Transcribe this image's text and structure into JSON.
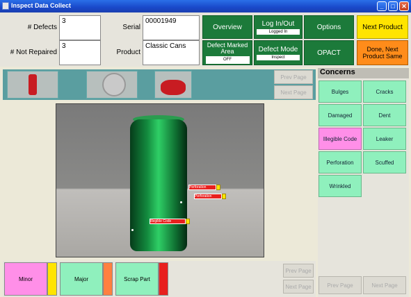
{
  "window": {
    "title": "Inspect Data Collect",
    "min": "_",
    "max": "□",
    "close": "✕"
  },
  "form": {
    "defects_label": "# Defects",
    "defects_value": "3",
    "not_repaired_label": "# Not Repaired",
    "not_repaired_value": "3",
    "serial_label": "Serial",
    "serial_value": "00001949",
    "product_label": "Product",
    "product_value": "Classic Cans"
  },
  "buttons": {
    "overview": "Overview",
    "login": "Log In/Out",
    "login_status": "Logged In",
    "options": "Options",
    "next_product": "Next Product",
    "defect_marked": "Defect Marked Area",
    "defect_marked_status": "OFF",
    "defect_mode": "Defect Mode",
    "defect_mode_status": "Inspect",
    "opact": "OPACT",
    "done_next": "Done, Next Product Same"
  },
  "pagination": {
    "prev_page": "Prev Page",
    "next_page": "Next Page"
  },
  "concerns": {
    "title": "Concerns",
    "items": [
      {
        "label": "Bulges"
      },
      {
        "label": "Cracks"
      },
      {
        "label": "Damaged"
      },
      {
        "label": "Dent"
      },
      {
        "label": "Illegible Code"
      },
      {
        "label": "Leaker"
      },
      {
        "label": "Perforation"
      },
      {
        "label": "Scuffed"
      },
      {
        "label": "Wrinkled"
      }
    ]
  },
  "severity": {
    "minor": "Minor",
    "major": "Major",
    "scrap": "Scrap Part",
    "minor_color": "#ff8fe8",
    "minor_flag": "#ffe400",
    "major_color": "#8ff0bd",
    "major_flag": "#ff8040",
    "scrap_color": "#8ff0bd",
    "scrap_flag": "#e8201e"
  },
  "defect_tags": [
    "Perforation",
    "Perforation",
    "Illegible Code"
  ]
}
